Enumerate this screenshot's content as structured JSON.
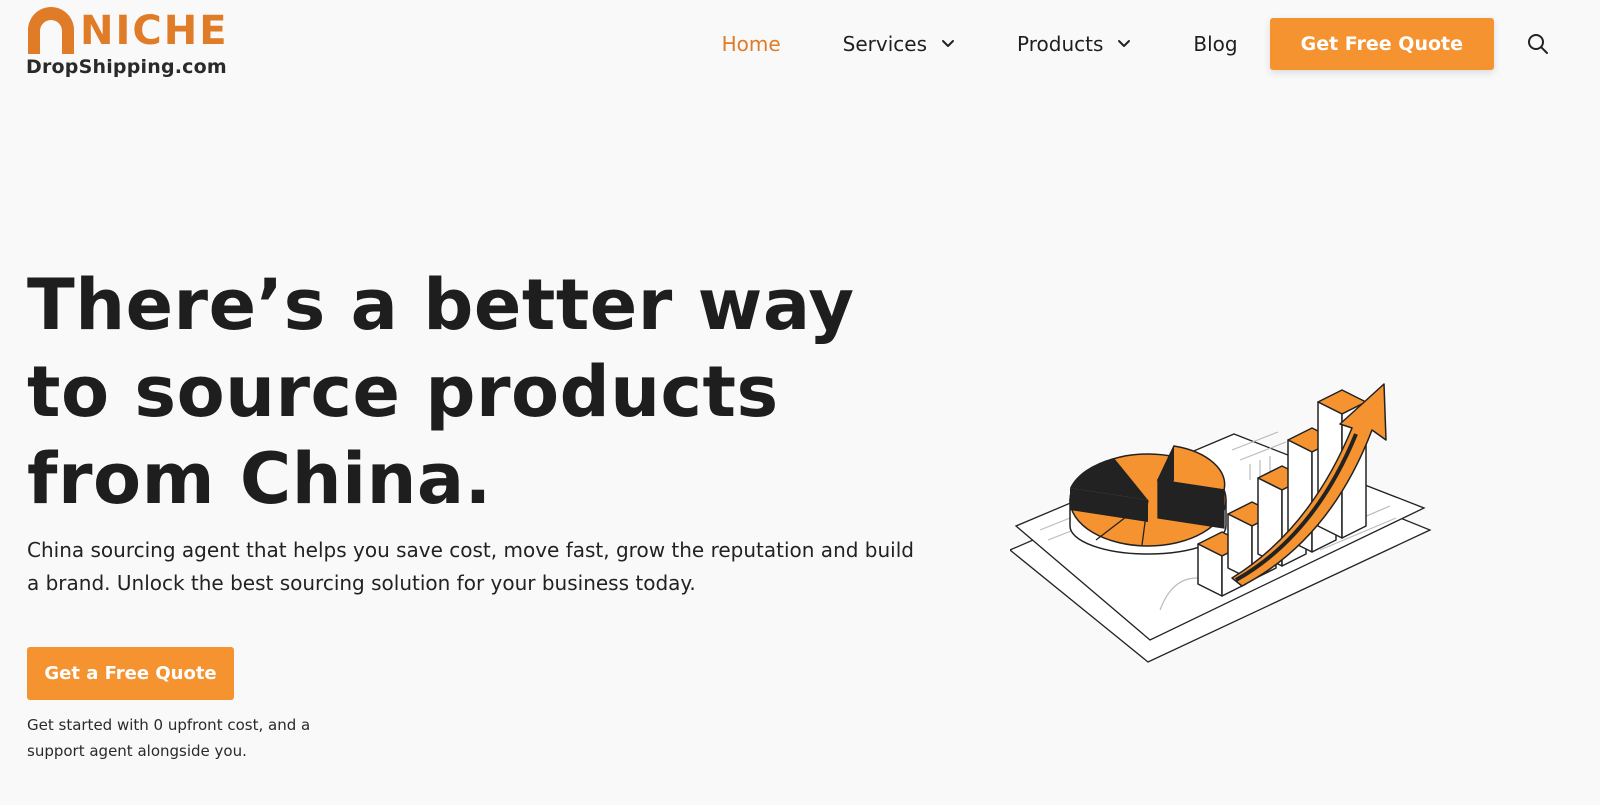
{
  "logo": {
    "word": "NICHE",
    "sub": "DropShipping.com"
  },
  "nav": {
    "home": "Home",
    "services": "Services",
    "products": "Products",
    "blog": "Blog",
    "cta": "Get Free Quote"
  },
  "hero": {
    "title": "There’s a better way to source products from China.",
    "subtitle": "China sourcing agent that helps you save cost, move fast, grow the reputation and build a brand. Unlock the best sourcing solution for your business today.",
    "cta": "Get a Free Quote",
    "note": "Get started with 0 upfront cost, and a support agent alongside you."
  },
  "colors": {
    "accent": "#f59331",
    "brand": "#e07b28",
    "text": "#1e1e1e",
    "background": "#f9f9f9"
  },
  "icons": [
    "logo-arch-icon",
    "chevron-down-icon",
    "search-icon",
    "growth-chart-illustration"
  ]
}
